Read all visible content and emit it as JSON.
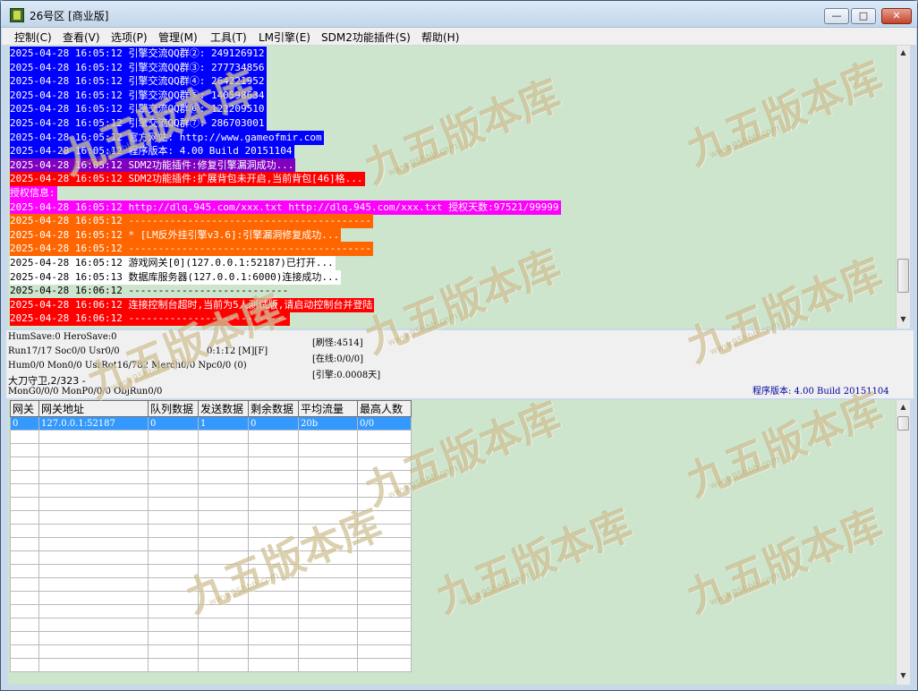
{
  "window": {
    "title": "26号区 [商业版]",
    "min": "—",
    "max": "□",
    "close": "✕"
  },
  "menu": [
    "控制(C)",
    "查看(V)",
    "选项(P)",
    "管理(M)",
    "工具(T)",
    "LM引擎(E)",
    "SDM2功能插件(S)",
    "帮助(H)"
  ],
  "log": [
    {
      "text": "2025-04-28 16:05:12 引擎交流QQ群②: 249126912",
      "style": "blue"
    },
    {
      "text": "2025-04-28 16:05:12 引擎交流QQ群③: 277734856",
      "style": "blue"
    },
    {
      "text": "2025-04-28 16:05:12 引擎交流QQ群④: 264221952",
      "style": "blue"
    },
    {
      "text": "2025-04-28 16:05:12 引擎交流QQ群⑤: 140598634",
      "style": "blue"
    },
    {
      "text": "2025-04-28 16:05:12 引擎交流QQ群⑥: 122209510",
      "style": "blue"
    },
    {
      "text": "2025-04-28 16:05:12 引擎交流QQ群⑦: 286703001",
      "style": "blue"
    },
    {
      "text": "2025-04-28 16:05:12 官方网站: http://www.gameofmir.com",
      "style": "blue"
    },
    {
      "text": "2025-04-28 16:05:12 程序版本: 4.00 Build 20151104",
      "style": "blue"
    },
    {
      "text": "2025-04-28 16:05:12 SDM2功能插件:修复引擎漏洞成功...",
      "style": "purple"
    },
    {
      "text": "2025-04-28 16:05:12 SDM2功能插件:扩展背包未开启,当前背包[46]格...",
      "style": "red"
    },
    {
      "text": "授权信息:",
      "style": "magenta"
    },
    {
      "text": "2025-04-28 16:05:12 http://dlq.945.com/xxx.txt http://dlq.945.com/xxx.txt 授权天数:97521/99999",
      "style": "magenta"
    },
    {
      "text": "2025-04-28 16:05:12 -----------------------------------------",
      "style": "orange"
    },
    {
      "text": "2025-04-28 16:05:12 * [LM反外挂引擎v3.6]:引擎漏洞修复成功...",
      "style": "orange"
    },
    {
      "text": "2025-04-28 16:05:12 -----------------------------------------",
      "style": "orange"
    },
    {
      "text": "2025-04-28 16:05:12 游戏网关[0](127.0.0.1:52187)已打开...",
      "style": "white"
    },
    {
      "text": "2025-04-28 16:05:13 数据库服务器(127.0.0.1:6000)连接成功...",
      "style": "white"
    },
    {
      "text": "2025-04-28 16:06:12 ---------------------------",
      "style": "green"
    },
    {
      "text": "2025-04-28 16:06:12 连接控制台超时,当前为5人测试版,请启动控制台并登陆",
      "style": "red"
    },
    {
      "text": "2025-04-28 16:06:12 ---------------------------",
      "style": "red"
    }
  ],
  "status": {
    "humsave": "HumSave:0 HeroSave:0",
    "run": "Run17/17 Soc0/0 Usr0/0",
    "time": "0:1:12 [M][F]",
    "hum": "Hum0/0 Mon0/0 UsrRot16/782 Merch0/0 Npc0/0 (0)",
    "guard": "大刀守卫,2/323 -",
    "mon": "MonG0/0/0 MonP0/0/0 ObjRun0/0",
    "refresh": "[刷怪:4514]",
    "online": "[在线:0/0/0]",
    "engine": "[引擎:0.0008天]",
    "version": "程序版本: 4.00 Build 20151104"
  },
  "gateway_table": {
    "headers": [
      "网关",
      "网关地址",
      "队列数据",
      "发送数据",
      "剩余数据",
      "平均流量",
      "最高人数"
    ],
    "rows": [
      [
        "0",
        "127.0.0.1:52187",
        "0",
        "1",
        "0",
        "20b",
        "0/0"
      ]
    ],
    "empty_rows": 18
  },
  "watermark": {
    "text": "九五版本库",
    "url": "www.95bbb.com"
  }
}
